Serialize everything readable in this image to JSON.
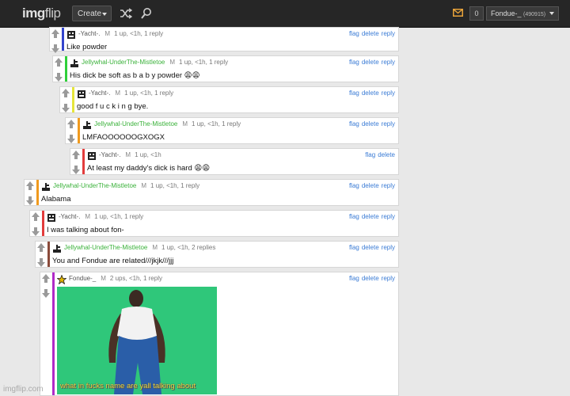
{
  "header": {
    "logo_part1": "img",
    "logo_part2": "flip",
    "create_label": "Create",
    "notif_count": "0",
    "username": "Fondue-_",
    "points": "(490915)"
  },
  "actions": {
    "flag": "flag",
    "delete": "delete",
    "reply": "reply"
  },
  "mod_mark": "M",
  "comments": [
    {
      "user": "-Yacht-.",
      "meta": "1 up, <1h, 1 reply",
      "text": "Like powder",
      "color": "#3344cc"
    },
    {
      "user": "Jellywhal-UnderThe-Mistletoe",
      "meta": "1 up, <1h, 1 reply",
      "text": "His dick be soft as b a b y powder 😩😩",
      "color": "#2fcf3a"
    },
    {
      "user": "-Yacht-.",
      "meta": "1 up, <1h, 1 reply",
      "text": "good f u c k i n g bye.",
      "color": "#e6e63a"
    },
    {
      "user": "Jellywhal-UnderThe-Mistletoe",
      "meta": "1 up, <1h, 1 reply",
      "text": "LMFAOOOOOOGXOGX",
      "color": "#f09a1e"
    },
    {
      "user": "-Yacht-.",
      "meta": "1 up, <1h",
      "text": "At least my daddy's dick is hard 😩😩",
      "color": "#e23c3c"
    },
    {
      "user": "Jellywhal-UnderThe-Mistletoe",
      "meta": "1 up, <1h, 1 reply",
      "text": "Alabama",
      "color": "#f09a1e"
    },
    {
      "user": "-Yacht-.",
      "meta": "1 up, <1h, 1 reply",
      "text": "I was talking about fon-",
      "color": "#e23c3c"
    },
    {
      "user": "Jellywhal-UnderThe-Mistletoe",
      "meta": "1 up, <1h, 2 replies",
      "text": "You and Fondue are related///jkjk///jjj",
      "color": "#8a4a3a"
    },
    {
      "user": "Fondue-_",
      "meta": "2 ups, <1h, 1 reply",
      "text": "",
      "color": "#b02ac8"
    }
  ],
  "meme_caption": "what in fucks name are yall talking about",
  "watermark": "imgflip.com"
}
